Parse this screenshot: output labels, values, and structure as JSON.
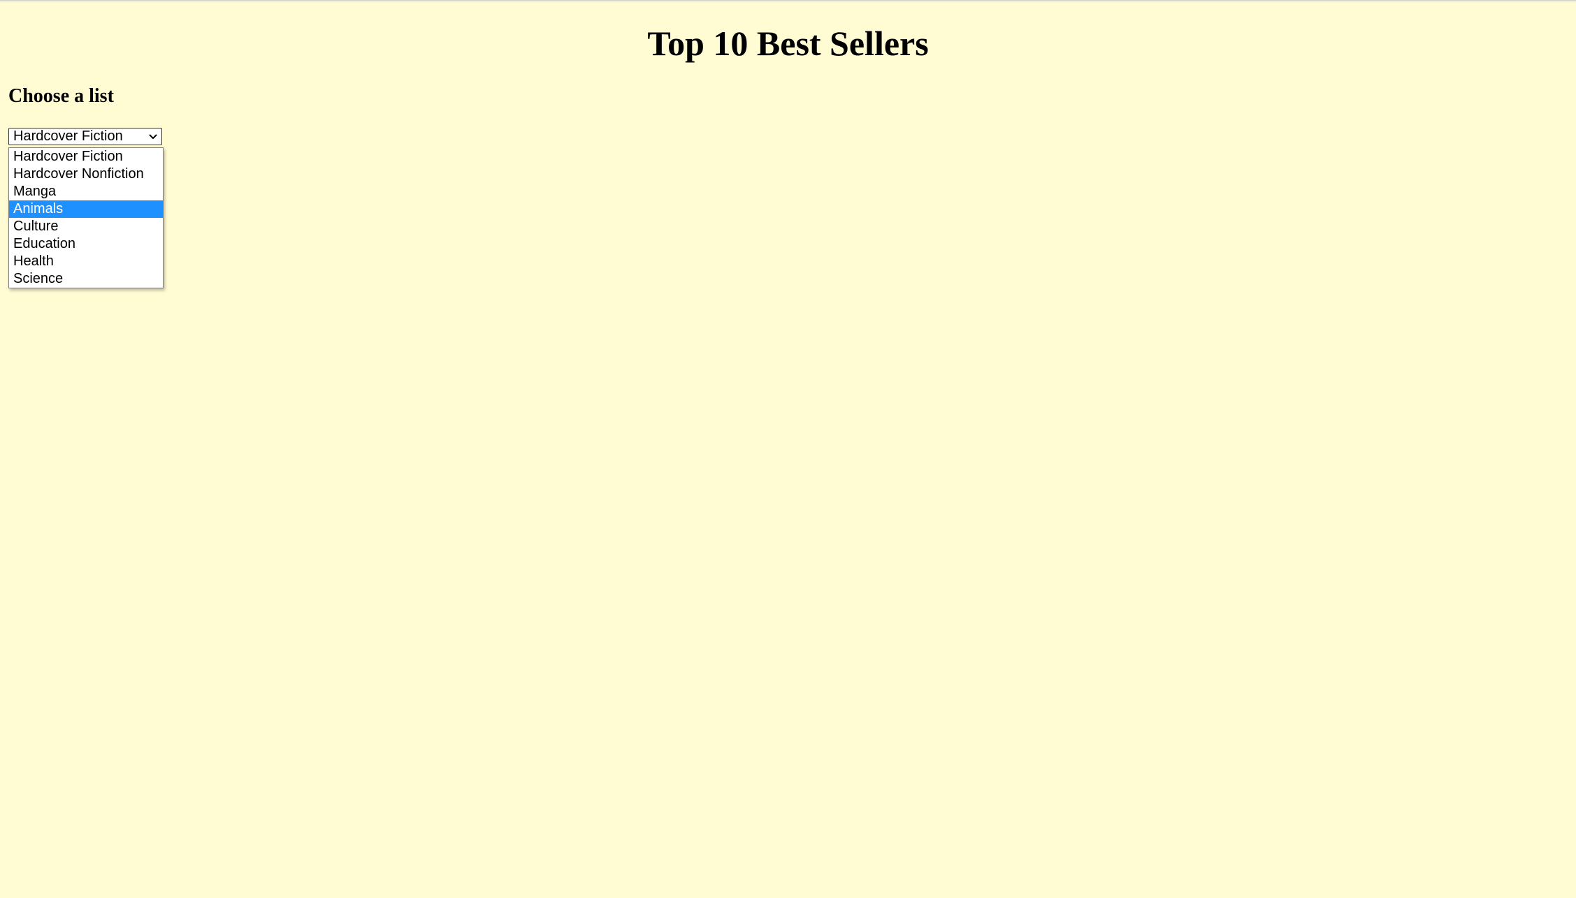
{
  "page": {
    "title": "Top 10 Best Sellers",
    "background_color": "#fffbd3"
  },
  "list_chooser": {
    "heading": "Choose a list",
    "selected_value": "Hardcover Fiction",
    "highlighted_option": "Animals",
    "highlight_color": "#1e90ff",
    "options": [
      "Hardcover Fiction",
      "Hardcover Nonfiction",
      "Manga",
      "Animals",
      "Culture",
      "Education",
      "Health",
      "Science"
    ],
    "chevron_icon": "chevron-down-icon"
  }
}
